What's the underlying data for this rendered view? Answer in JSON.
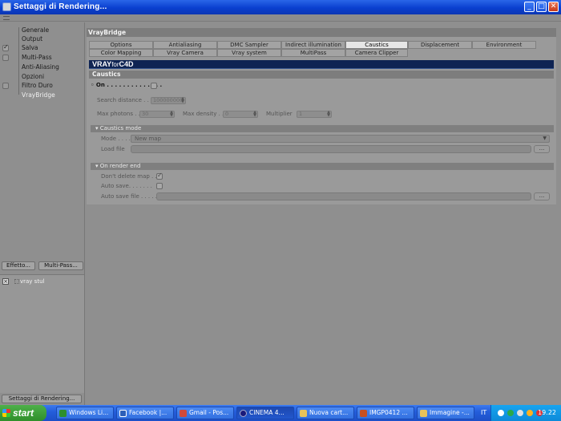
{
  "window": {
    "title": "Settaggi di Rendering..."
  },
  "sidebar": {
    "items": [
      {
        "label": "Generale",
        "check": "none"
      },
      {
        "label": "Output",
        "check": "none"
      },
      {
        "label": "Salva",
        "check": "tick"
      },
      {
        "label": "Multi-Pass",
        "check": "square"
      },
      {
        "label": "Anti-Aliasing",
        "check": "none"
      },
      {
        "label": "Opzioni",
        "check": "none"
      },
      {
        "label": "Filtro Duro",
        "check": "square"
      },
      {
        "label": "VrayBridge",
        "check": "none",
        "selected": true
      }
    ],
    "effect_button": "Effetto...",
    "multipass_button": "Multi-Pass...",
    "preset_label": "vray stul",
    "settings_button": "Settaggi di Rendering..."
  },
  "panel": {
    "header": "VrayBridge",
    "tabs_row1": [
      "Options",
      "Antialiasing",
      "DMC Sampler",
      "Indirect illumination (GI)",
      "Caustics",
      "Displacement",
      "Environment"
    ],
    "tabs_row2": [
      "Color Mapping",
      "Vray Camera",
      "Vray system",
      "MultiPass",
      "Camera Clipper"
    ],
    "active_tab": "Caustics",
    "banner": {
      "logo_main": "VRAY",
      "logo_for": "for",
      "logo_c4d": "C4D"
    },
    "section_title": "Caustics",
    "on_label": "On . . . . . . . . . . . . . .",
    "search_distance_label": "Search distance . . .",
    "search_distance_value": "100000000",
    "max_photons_label": "Max photons . .",
    "max_photons_value": "30",
    "max_density_label": "Max density . .",
    "max_density_value": "0",
    "multiplier_label": "Multiplier",
    "multiplier_value": "1",
    "caustics_mode_header": "Caustics mode",
    "mode_label": "Mode . . . . .",
    "mode_value": "New map",
    "load_file_label": "Load file",
    "browse_label": "...",
    "on_render_end_header": "On render end",
    "dont_delete_label": "Don't delete map . .",
    "auto_save_label": "Auto save. . . . . . .",
    "auto_save_file_label": "Auto save file . . . . . ."
  },
  "taskbar": {
    "start": "start",
    "tasks": [
      {
        "label": "Windows Li...",
        "color": "#2d8f2d"
      },
      {
        "label": "Facebook |...",
        "color": "#2d5fb8"
      },
      {
        "label": "Gmail - Pos...",
        "color": "#d04a3a"
      },
      {
        "label": "CINEMA 4...",
        "color": "#1a1a7a"
      },
      {
        "label": "Nuova cart...",
        "color": "#e8c35a"
      },
      {
        "label": "IMGP0412 ...",
        "color": "#c85020"
      },
      {
        "label": "Immagine -...",
        "color": "#e8c35a"
      }
    ],
    "language": "IT",
    "clock": "19.22"
  }
}
